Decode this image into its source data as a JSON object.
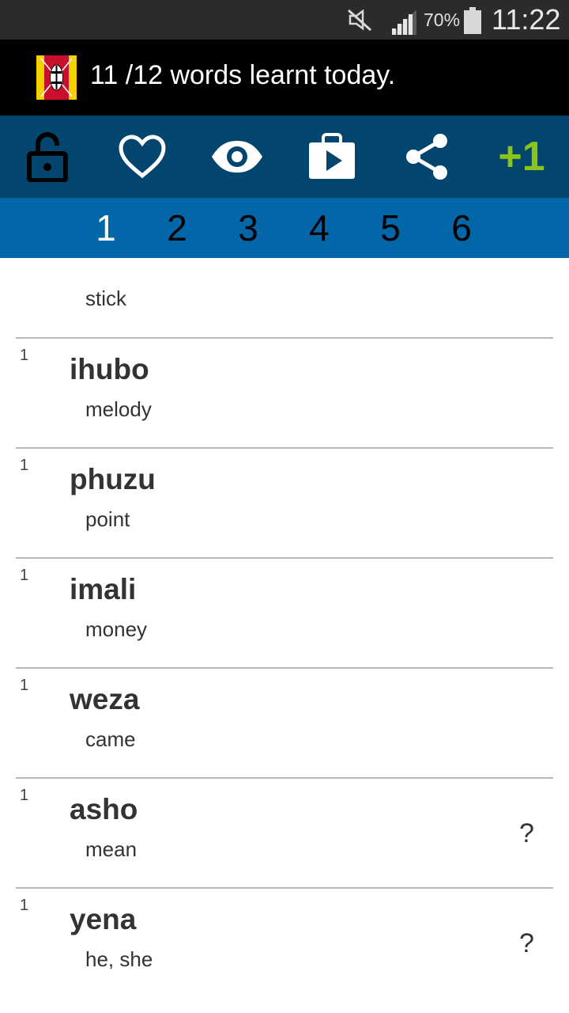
{
  "status_bar": {
    "battery_percent": "70%",
    "time": "11:22",
    "icons": [
      "mute-icon",
      "signal-icon",
      "battery-icon"
    ]
  },
  "header": {
    "title": "11 /12 words learnt today.",
    "flag_colors": [
      "#f7d000",
      "#c8102e",
      "#000000"
    ]
  },
  "toolbar": {
    "icons": [
      "unlock-icon",
      "heart-icon",
      "eye-icon",
      "play-store-icon",
      "share-icon"
    ],
    "plus_one": "+1",
    "accent": "#8bc414"
  },
  "levels": {
    "tabs": [
      "1",
      "2",
      "3",
      "4",
      "5",
      "6"
    ],
    "active": "1"
  },
  "words": {
    "first_meaning": "stick",
    "items": [
      {
        "count": "1",
        "word": "ihubo",
        "meaning": "melody",
        "question": ""
      },
      {
        "count": "1",
        "word": "phuzu",
        "meaning": "point",
        "question": ""
      },
      {
        "count": "1",
        "word": "imali",
        "meaning": "money",
        "question": ""
      },
      {
        "count": "1",
        "word": "weza",
        "meaning": "came",
        "question": ""
      },
      {
        "count": "1",
        "word": "asho",
        "meaning": "mean",
        "question": "?"
      },
      {
        "count": "1",
        "word": "yena",
        "meaning": "he, she",
        "question": "?"
      }
    ]
  }
}
